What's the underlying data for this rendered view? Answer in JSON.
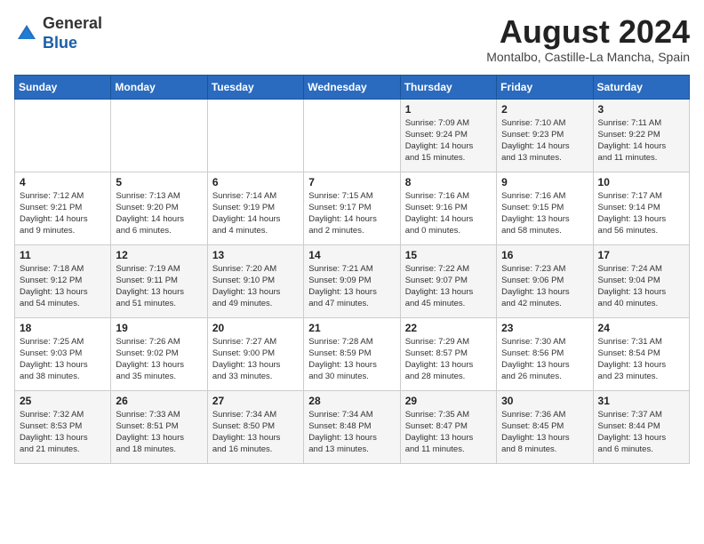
{
  "header": {
    "logo_line1": "General",
    "logo_line2": "Blue",
    "month_title": "August 2024",
    "subtitle": "Montalbo, Castille-La Mancha, Spain"
  },
  "weekdays": [
    "Sunday",
    "Monday",
    "Tuesday",
    "Wednesday",
    "Thursday",
    "Friday",
    "Saturday"
  ],
  "weeks": [
    [
      {
        "day": "",
        "detail": ""
      },
      {
        "day": "",
        "detail": ""
      },
      {
        "day": "",
        "detail": ""
      },
      {
        "day": "",
        "detail": ""
      },
      {
        "day": "1",
        "detail": "Sunrise: 7:09 AM\nSunset: 9:24 PM\nDaylight: 14 hours\nand 15 minutes."
      },
      {
        "day": "2",
        "detail": "Sunrise: 7:10 AM\nSunset: 9:23 PM\nDaylight: 14 hours\nand 13 minutes."
      },
      {
        "day": "3",
        "detail": "Sunrise: 7:11 AM\nSunset: 9:22 PM\nDaylight: 14 hours\nand 11 minutes."
      }
    ],
    [
      {
        "day": "4",
        "detail": "Sunrise: 7:12 AM\nSunset: 9:21 PM\nDaylight: 14 hours\nand 9 minutes."
      },
      {
        "day": "5",
        "detail": "Sunrise: 7:13 AM\nSunset: 9:20 PM\nDaylight: 14 hours\nand 6 minutes."
      },
      {
        "day": "6",
        "detail": "Sunrise: 7:14 AM\nSunset: 9:19 PM\nDaylight: 14 hours\nand 4 minutes."
      },
      {
        "day": "7",
        "detail": "Sunrise: 7:15 AM\nSunset: 9:17 PM\nDaylight: 14 hours\nand 2 minutes."
      },
      {
        "day": "8",
        "detail": "Sunrise: 7:16 AM\nSunset: 9:16 PM\nDaylight: 14 hours\nand 0 minutes."
      },
      {
        "day": "9",
        "detail": "Sunrise: 7:16 AM\nSunset: 9:15 PM\nDaylight: 13 hours\nand 58 minutes."
      },
      {
        "day": "10",
        "detail": "Sunrise: 7:17 AM\nSunset: 9:14 PM\nDaylight: 13 hours\nand 56 minutes."
      }
    ],
    [
      {
        "day": "11",
        "detail": "Sunrise: 7:18 AM\nSunset: 9:12 PM\nDaylight: 13 hours\nand 54 minutes."
      },
      {
        "day": "12",
        "detail": "Sunrise: 7:19 AM\nSunset: 9:11 PM\nDaylight: 13 hours\nand 51 minutes."
      },
      {
        "day": "13",
        "detail": "Sunrise: 7:20 AM\nSunset: 9:10 PM\nDaylight: 13 hours\nand 49 minutes."
      },
      {
        "day": "14",
        "detail": "Sunrise: 7:21 AM\nSunset: 9:09 PM\nDaylight: 13 hours\nand 47 minutes."
      },
      {
        "day": "15",
        "detail": "Sunrise: 7:22 AM\nSunset: 9:07 PM\nDaylight: 13 hours\nand 45 minutes."
      },
      {
        "day": "16",
        "detail": "Sunrise: 7:23 AM\nSunset: 9:06 PM\nDaylight: 13 hours\nand 42 minutes."
      },
      {
        "day": "17",
        "detail": "Sunrise: 7:24 AM\nSunset: 9:04 PM\nDaylight: 13 hours\nand 40 minutes."
      }
    ],
    [
      {
        "day": "18",
        "detail": "Sunrise: 7:25 AM\nSunset: 9:03 PM\nDaylight: 13 hours\nand 38 minutes."
      },
      {
        "day": "19",
        "detail": "Sunrise: 7:26 AM\nSunset: 9:02 PM\nDaylight: 13 hours\nand 35 minutes."
      },
      {
        "day": "20",
        "detail": "Sunrise: 7:27 AM\nSunset: 9:00 PM\nDaylight: 13 hours\nand 33 minutes."
      },
      {
        "day": "21",
        "detail": "Sunrise: 7:28 AM\nSunset: 8:59 PM\nDaylight: 13 hours\nand 30 minutes."
      },
      {
        "day": "22",
        "detail": "Sunrise: 7:29 AM\nSunset: 8:57 PM\nDaylight: 13 hours\nand 28 minutes."
      },
      {
        "day": "23",
        "detail": "Sunrise: 7:30 AM\nSunset: 8:56 PM\nDaylight: 13 hours\nand 26 minutes."
      },
      {
        "day": "24",
        "detail": "Sunrise: 7:31 AM\nSunset: 8:54 PM\nDaylight: 13 hours\nand 23 minutes."
      }
    ],
    [
      {
        "day": "25",
        "detail": "Sunrise: 7:32 AM\nSunset: 8:53 PM\nDaylight: 13 hours\nand 21 minutes."
      },
      {
        "day": "26",
        "detail": "Sunrise: 7:33 AM\nSunset: 8:51 PM\nDaylight: 13 hours\nand 18 minutes."
      },
      {
        "day": "27",
        "detail": "Sunrise: 7:34 AM\nSunset: 8:50 PM\nDaylight: 13 hours\nand 16 minutes."
      },
      {
        "day": "28",
        "detail": "Sunrise: 7:34 AM\nSunset: 8:48 PM\nDaylight: 13 hours\nand 13 minutes."
      },
      {
        "day": "29",
        "detail": "Sunrise: 7:35 AM\nSunset: 8:47 PM\nDaylight: 13 hours\nand 11 minutes."
      },
      {
        "day": "30",
        "detail": "Sunrise: 7:36 AM\nSunset: 8:45 PM\nDaylight: 13 hours\nand 8 minutes."
      },
      {
        "day": "31",
        "detail": "Sunrise: 7:37 AM\nSunset: 8:44 PM\nDaylight: 13 hours\nand 6 minutes."
      }
    ]
  ]
}
